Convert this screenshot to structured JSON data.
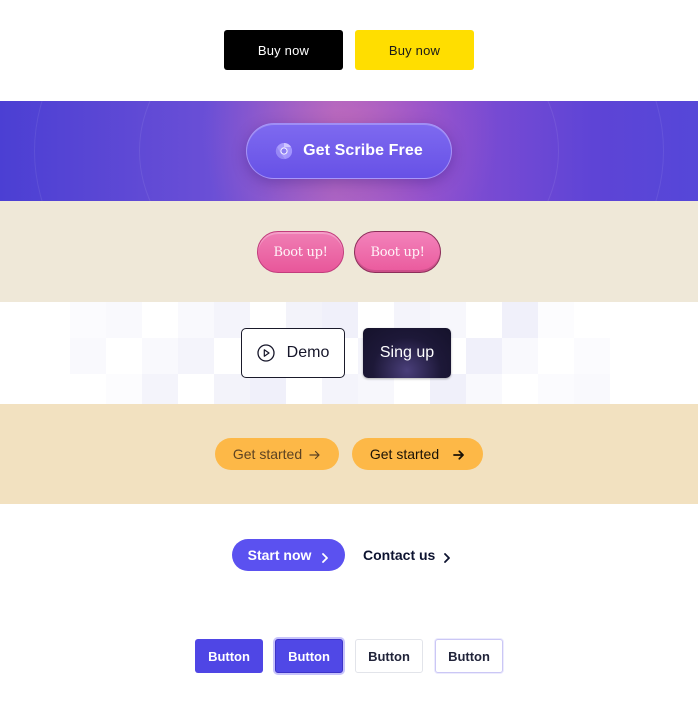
{
  "colors": {
    "black_button": "#000000",
    "yellow_button": "#ffde00",
    "scribe_gradient_start": "#4b3fd3",
    "scribe_button": "#7e6af0",
    "boot_background": "#efe8d8",
    "boot_pink": "#ea5a9d",
    "signup_dark": "#1d1838",
    "get_started_background": "#f2e1c0",
    "get_started_orange": "#fdb847",
    "start_now_purple": "#5b51f0",
    "contact_text": "#0d1330",
    "indigo_button": "#4f46e5"
  },
  "row_buy": {
    "black_label": "Buy  now",
    "yellow_label": "Buy  now"
  },
  "row_scribe": {
    "icon": "chrome-icon",
    "label": "Get Scribe Free"
  },
  "row_boot": {
    "first_label": "Boot up!",
    "second_label": "Boot up!"
  },
  "row_demo": {
    "demo_icon": "play-circle-icon",
    "demo_label": "Demo",
    "signup_label": "Sing up"
  },
  "row_get_started": {
    "first_label": "Get started",
    "first_icon": "arrow-right-icon",
    "second_label": "Get started",
    "second_icon": "arrow-right-icon"
  },
  "row_start": {
    "start_label": "Start now",
    "start_icon": "chevron-right-icon",
    "contact_label": "Contact us",
    "contact_icon": "chevron-right-icon"
  },
  "row_buttons": {
    "labels": [
      "Button",
      "Button",
      "Button",
      "Button"
    ]
  }
}
